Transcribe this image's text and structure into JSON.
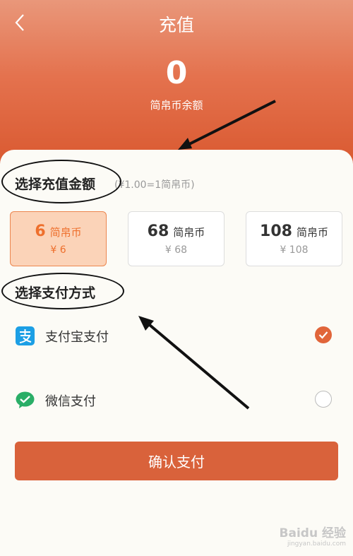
{
  "header": {
    "title": "充值",
    "balance": "0",
    "balance_label": "简帛币余额"
  },
  "recharge": {
    "section_title": "选择充值金额",
    "rate_hint": "(¥1.00=1简帛币)",
    "options": [
      {
        "coins": "6",
        "unit": "简帛币",
        "price": "¥ 6",
        "selected": true
      },
      {
        "coins": "68",
        "unit": "简帛币",
        "price": "¥ 68",
        "selected": false
      },
      {
        "coins": "108",
        "unit": "简帛币",
        "price": "¥ 108",
        "selected": false
      }
    ]
  },
  "payment": {
    "section_title": "选择支付方式",
    "methods": [
      {
        "label": "支付宝支付",
        "icon": "alipay-icon",
        "selected": true
      },
      {
        "label": "微信支付",
        "icon": "wechat-pay-icon",
        "selected": false
      }
    ]
  },
  "confirm_label": "确认支付",
  "watermark": {
    "text": "Baidu 经验",
    "sub": "jingyan.baidu.com"
  },
  "colors": {
    "header_top": "#e9977a",
    "header_bottom": "#d9582f",
    "accent": "#e1653a",
    "selected_bg": "#fbd3b8",
    "alipay_blue": "#1c9fe5",
    "wechat_green": "#2aae67"
  }
}
